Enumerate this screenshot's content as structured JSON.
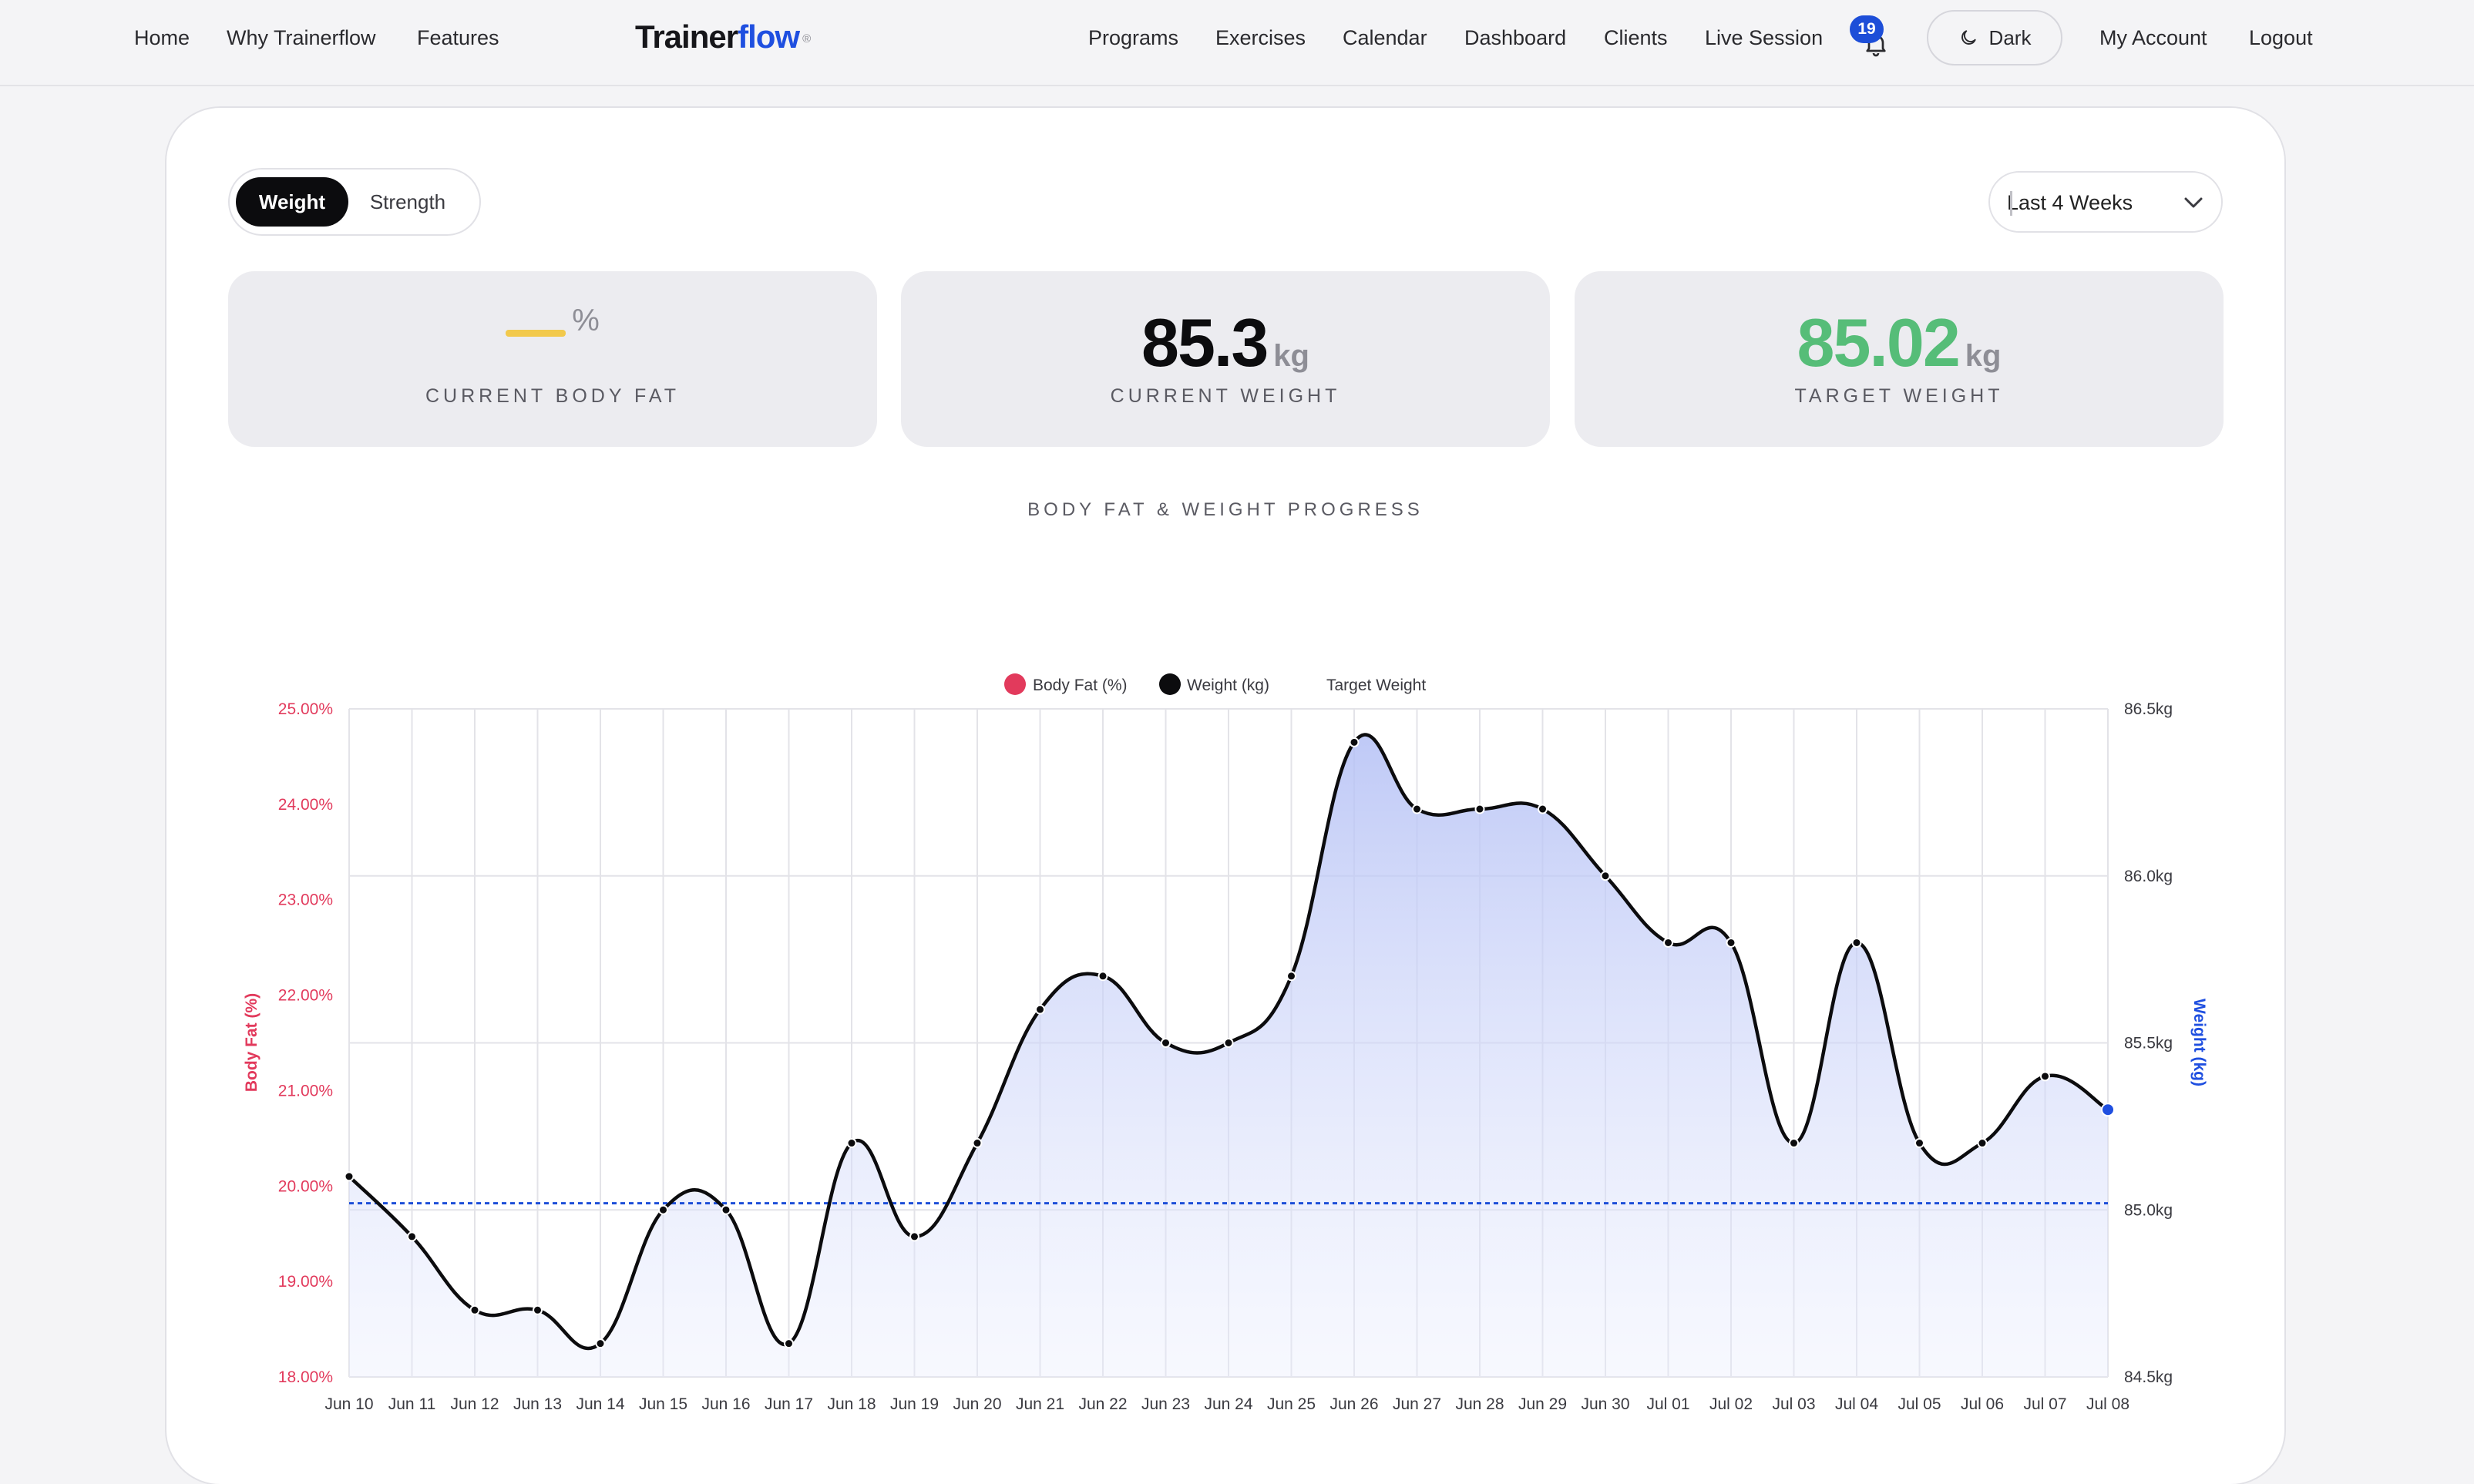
{
  "nav": {
    "left": [
      "Home",
      "Why Trainerflow",
      "Features"
    ],
    "logo_a": "Trainer",
    "logo_b": "flow",
    "logo_reg": "®",
    "right": [
      "Programs",
      "Exercises",
      "Calendar",
      "Dashboard",
      "Clients",
      "Live Session"
    ],
    "notification_count": "19",
    "theme_label": "Dark",
    "account": "My Account",
    "logout": "Logout"
  },
  "toggle": {
    "options": [
      "Weight",
      "Strength"
    ],
    "selected": "Weight"
  },
  "range": {
    "selected": "Last 4 Weeks"
  },
  "stats": [
    {
      "value": "",
      "unit": "%",
      "label": "CURRENT BODY FAT"
    },
    {
      "value": "85.3",
      "unit": "kg",
      "label": "CURRENT WEIGHT"
    },
    {
      "value": "85.02",
      "unit": "kg",
      "label": "TARGET WEIGHT"
    }
  ],
  "colors": {
    "accent": "#1f4fe0",
    "bodyfat": "#e23a5c",
    "target": "#56bd78",
    "bodyfat_empty": "#f2c94c",
    "weight_line": "#0c0c0e",
    "fill": "#c7d0f7"
  },
  "chart_data": {
    "type": "line",
    "title": "BODY FAT & WEIGHT PROGRESS",
    "legend": [
      "Body Fat (%)",
      "Weight (kg)",
      "Target Weight"
    ],
    "legend_position": "top",
    "x": [
      "Jun 10",
      "Jun 11",
      "Jun 12",
      "Jun 13",
      "Jun 14",
      "Jun 15",
      "Jun 16",
      "Jun 17",
      "Jun 18",
      "Jun 19",
      "Jun 20",
      "Jun 21",
      "Jun 22",
      "Jun 23",
      "Jun 24",
      "Jun 25",
      "Jun 26",
      "Jun 27",
      "Jun 28",
      "Jun 29",
      "Jun 30",
      "Jul 01",
      "Jul 02",
      "Jul 03",
      "Jul 04",
      "Jul 05",
      "Jul 06",
      "Jul 07",
      "Jul 08"
    ],
    "series": [
      {
        "name": "Weight (kg)",
        "axis": "right",
        "values": [
          85.1,
          84.92,
          84.7,
          84.7,
          84.6,
          85.0,
          85.0,
          84.6,
          85.2,
          84.92,
          85.2,
          85.6,
          85.7,
          85.5,
          85.5,
          85.7,
          86.4,
          86.2,
          86.2,
          86.2,
          86.0,
          85.8,
          85.8,
          85.2,
          85.8,
          85.2,
          85.2,
          85.4,
          85.3
        ]
      },
      {
        "name": "Target Weight",
        "axis": "right",
        "values": [
          85.02
        ]
      }
    ],
    "ylabel_left": "Body Fat (%)",
    "ylim_left": [
      18,
      25
    ],
    "yticks_left": [
      "25.00%",
      "24.00%",
      "23.00%",
      "22.00%",
      "21.00%",
      "20.00%",
      "19.00%",
      "18.00%"
    ],
    "ylabel_right": "Weight (kg)",
    "ylim_right": [
      84.5,
      86.5
    ],
    "yticks_right": [
      "86.5kg",
      "86.0kg",
      "85.5kg",
      "85.0kg",
      "84.5kg"
    ],
    "grid": true
  }
}
